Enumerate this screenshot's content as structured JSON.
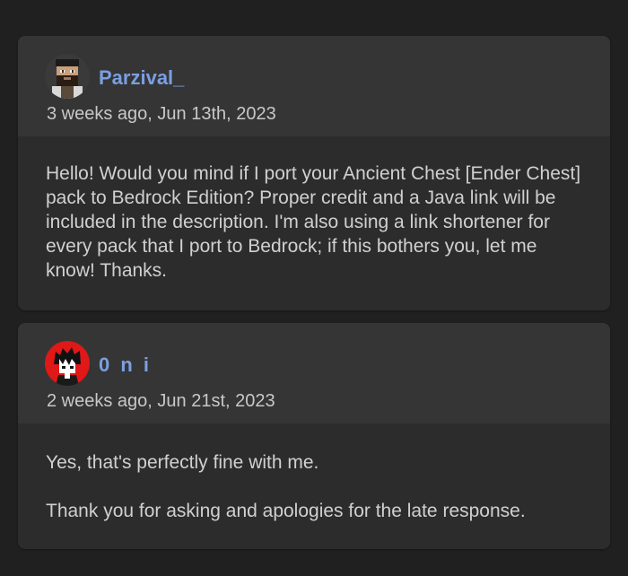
{
  "comments": [
    {
      "username": "Parzival_",
      "timestamp": "3 weeks ago, Jun 13th, 2023",
      "avatar_icon": "pixel-bearded-man-avatar",
      "paragraphs": [
        "Hello! Would you mind if I port your Ancient Chest [Ender Chest] pack to Bedrock Edition? Proper credit and a Java link will be included in the description. I'm also using a link shortener for every pack that I port to Bedrock; if this bothers you, let me know! Thanks."
      ]
    },
    {
      "username": "0 n i",
      "timestamp": "2 weeks ago, Jun 21st, 2023",
      "avatar_icon": "red-anime-character-avatar",
      "paragraphs": [
        "Yes, that's perfectly fine with me.",
        "Thank you for asking and apologies for the late response."
      ]
    }
  ],
  "colors": {
    "background": "#202020",
    "card": "#2c2c2d",
    "card_header": "#353536",
    "username": "#7b9fe0",
    "text": "#d0d0d0"
  }
}
